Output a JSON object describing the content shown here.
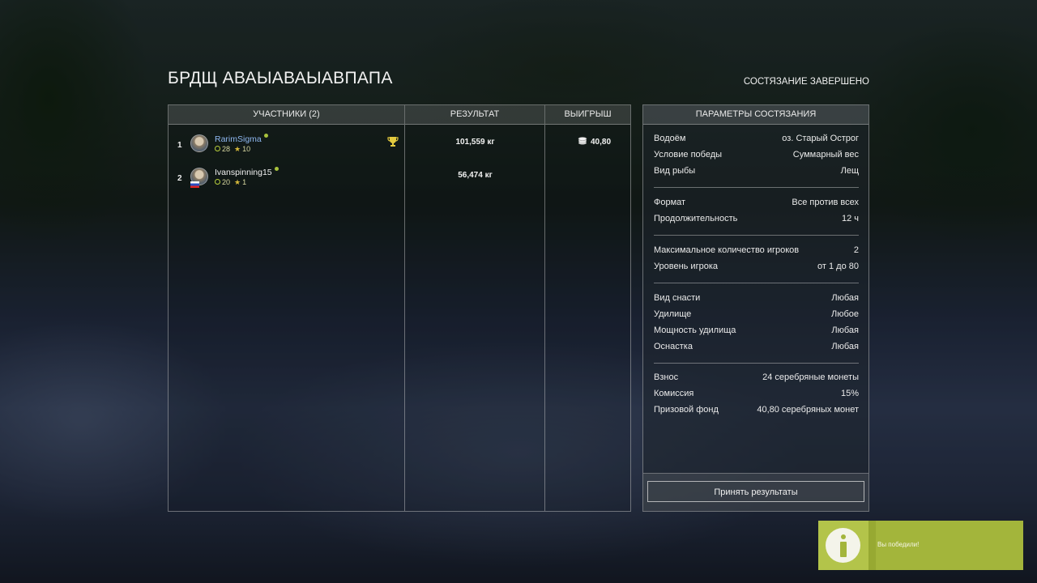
{
  "header": {
    "title": "БРДЩ АВАЫАВАЫАВПАПА",
    "status": "СОСТЯЗАНИЕ ЗАВЕРШЕНО"
  },
  "results": {
    "columns": {
      "participants": "УЧАСТНИКИ (2)",
      "result": "РЕЗУЛЬТАТ",
      "prize": "ВЫИГРЫШ"
    },
    "rows": [
      {
        "rank": "1",
        "name": "RarimSigma",
        "level": "28",
        "stars": "10",
        "result": "101,559 кг",
        "prize": "40,80"
      },
      {
        "rank": "2",
        "name": "Ivanspinning15",
        "level": "20",
        "stars": "1",
        "result": "56,474 кг",
        "prize": ""
      }
    ]
  },
  "params": {
    "title": "ПАРАМЕТРЫ СОСТЯЗАНИЯ",
    "group1": [
      {
        "k": "Водоём",
        "v": "оз. Старый Острог"
      },
      {
        "k": "Условие победы",
        "v": "Суммарный вес"
      },
      {
        "k": "Вид рыбы",
        "v": "Лещ"
      }
    ],
    "group2": [
      {
        "k": "Формат",
        "v": "Все против всех"
      },
      {
        "k": "Продолжительность",
        "v": "12 ч"
      }
    ],
    "group3": [
      {
        "k": "Максимальное количество игроков",
        "v": "2"
      },
      {
        "k": "Уровень игрока",
        "v": "от 1 до 80"
      }
    ],
    "group4": [
      {
        "k": "Вид снасти",
        "v": "Любая"
      },
      {
        "k": "Удилище",
        "v": "Любое"
      },
      {
        "k": "Мощность удилища",
        "v": "Любая"
      },
      {
        "k": "Оснастка",
        "v": "Любая"
      }
    ],
    "group5": [
      {
        "k": "Взнос",
        "v": "24 серебряные монеты"
      },
      {
        "k": "Комиссия",
        "v": "15%"
      },
      {
        "k": "Призовой фонд",
        "v": "40,80 серебряных монет"
      }
    ],
    "accept_label": "Принять результаты"
  },
  "toast": {
    "message": "Вы победили!"
  },
  "colors": {
    "accent": "#a3b53b",
    "player1_name": "#8fb7f0",
    "online": "#a8c23c"
  }
}
